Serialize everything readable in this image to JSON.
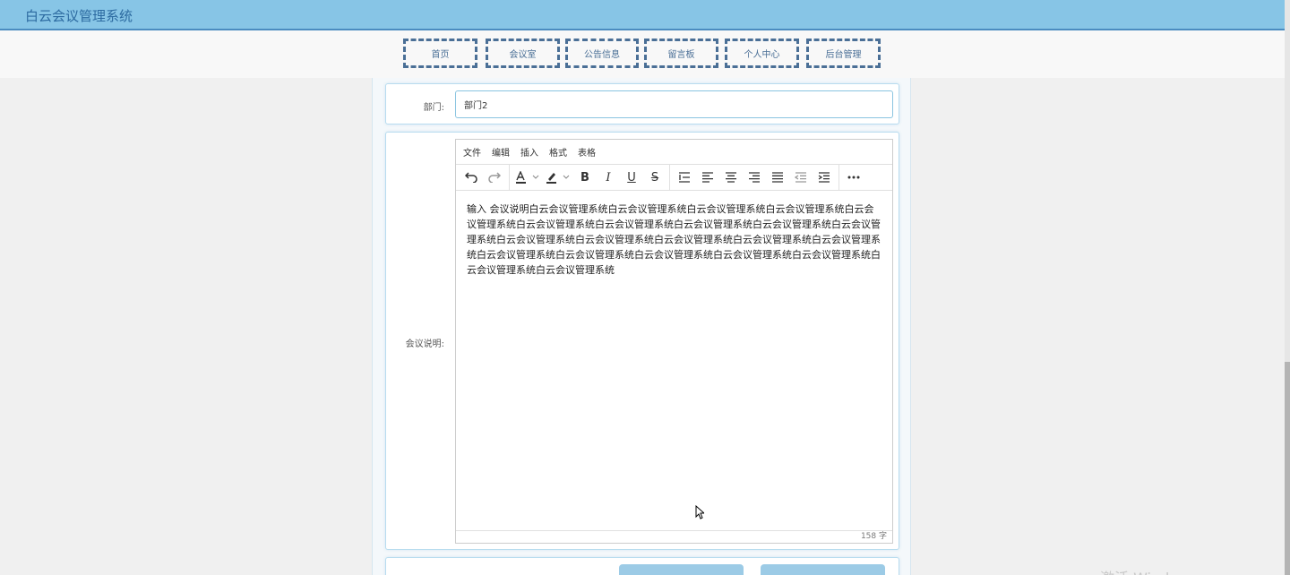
{
  "app": {
    "title": "白云会议管理系统"
  },
  "nav": {
    "items": [
      {
        "label": "首页"
      },
      {
        "label": "会议室"
      },
      {
        "label": "公告信息"
      },
      {
        "label": "留言板"
      },
      {
        "label": "个人中心"
      },
      {
        "label": "后台管理"
      }
    ]
  },
  "form": {
    "dept_label": "部门:",
    "dept_value": "部门2",
    "desc_label": "会议说明:"
  },
  "editor": {
    "menus": [
      "文件",
      "编辑",
      "插入",
      "格式",
      "表格"
    ],
    "content": "输入 会议说明白云会议管理系统白云会议管理系统白云会议管理系统白云会议管理系统白云会议管理系统白云会议管理系统白云会议管理系统白云会议管理系统白云会议管理系统白云会议管理系统白云会议管理系统白云会议管理系统白云会议管理系统白云会议管理系统白云会议管理系统白云会议管理系统白云会议管理系统白云会议管理系统白云会议管理系统白云会议管理系统白云会议管理系统白云会议管理系统",
    "word_count": "158 字",
    "toolbar_icons": [
      "undo-icon",
      "redo-icon",
      "font-color-icon",
      "highlight-icon",
      "bold-icon",
      "italic-icon",
      "underline-icon",
      "strikethrough-icon",
      "line-height-icon",
      "align-left-icon",
      "align-center-icon",
      "align-right-icon",
      "justify-icon",
      "outdent-icon",
      "indent-icon",
      "more-icon"
    ]
  },
  "watermark": "激活 Windows",
  "colors": {
    "header_bg": "#87c5e6",
    "nav_border": "#4a6f96",
    "button_bg": "#9ccbe6",
    "card_border": "#b8dcef"
  }
}
